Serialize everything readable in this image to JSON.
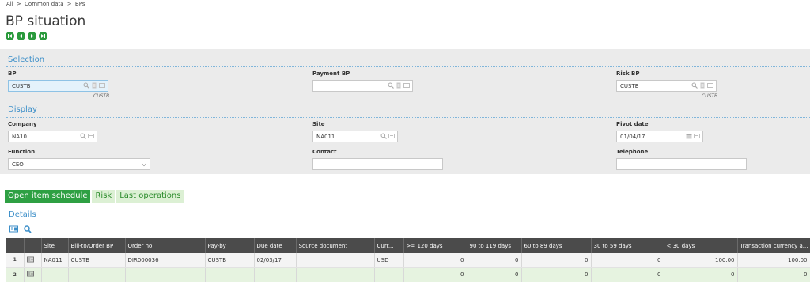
{
  "breadcrumb": [
    "All",
    ">",
    "Common data",
    ">",
    "BPs"
  ],
  "title": "BP situation",
  "selection": {
    "title": "Selection",
    "bp": {
      "label": "BP",
      "value": "CUSTB",
      "sub": "CUSTB"
    },
    "payment_bp": {
      "label": "Payment BP",
      "value": ""
    },
    "risk_bp": {
      "label": "Risk BP",
      "value": "CUSTB",
      "sub": "CUSTB"
    }
  },
  "display": {
    "title": "Display",
    "company": {
      "label": "Company",
      "value": "NA10"
    },
    "site": {
      "label": "Site",
      "value": "NA011"
    },
    "pivot_date": {
      "label": "Pivot date",
      "value": "01/04/17"
    },
    "function": {
      "label": "Function",
      "value": "CEO"
    },
    "contact": {
      "label": "Contact",
      "value": ""
    },
    "telephone": {
      "label": "Telephone",
      "value": ""
    }
  },
  "tabs": [
    "Open item schedule",
    "Risk",
    "Last operations"
  ],
  "details": {
    "title": "Details",
    "columns": [
      "",
      "",
      "Site",
      "Bill-to/Order BP",
      "Order no.",
      "Pay-by",
      "Due date",
      "Source document",
      "Curr...",
      ">= 120 days",
      "90 to 119 days",
      "60 to 89 days",
      "30 to 59 days",
      "< 30 days",
      "Transaction currency a..."
    ],
    "rows": [
      [
        "1",
        "",
        "NA011",
        "CUSTB",
        "DIR000036",
        "CUSTB",
        "02/03/17",
        "",
        "USD",
        "0",
        "0",
        "0",
        "0",
        "100.00",
        "100.00"
      ],
      [
        "2",
        "",
        "",
        "",
        "",
        "",
        "",
        "",
        "",
        "0",
        "0",
        "0",
        "0",
        "0",
        "0"
      ]
    ]
  },
  "colors": {
    "accent": "#3b8ec8",
    "tab_active": "#2ea043",
    "nav_green": "#2a9a3c",
    "grid_header": "#4b4b4b"
  }
}
